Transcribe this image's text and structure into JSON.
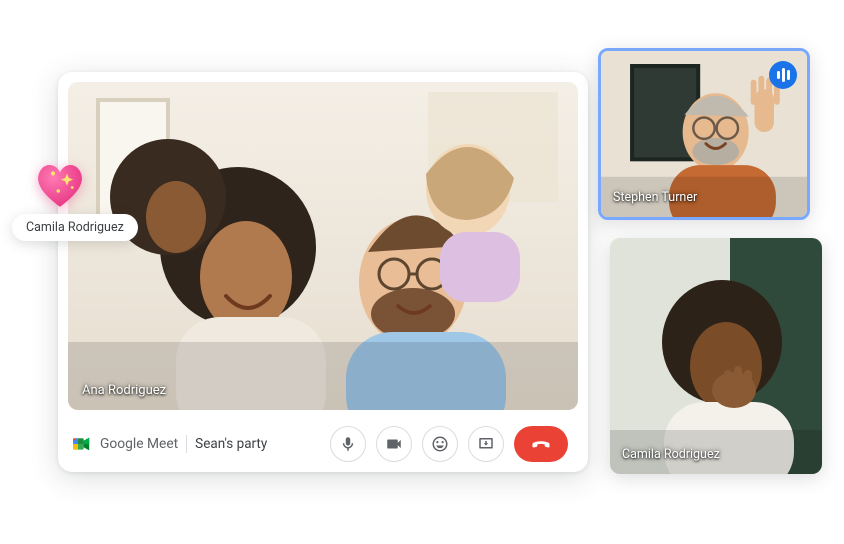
{
  "app": {
    "brand": "Google Meet",
    "meeting_title": "Sean's party"
  },
  "main_tile": {
    "name": "Ana Rodriguez"
  },
  "side_tiles": [
    {
      "name": "Stephen Turner",
      "speaking": true
    },
    {
      "name": "Camila Rodriguez",
      "speaking": false
    }
  ],
  "reaction": {
    "icon": "sparkle-heart",
    "sender": "Camila Rodriguez"
  },
  "controls": {
    "mic": "microphone-icon",
    "camera": "camera-icon",
    "emoji": "emoji-icon",
    "present": "present-screen-icon",
    "hangup": "hangup-icon"
  }
}
